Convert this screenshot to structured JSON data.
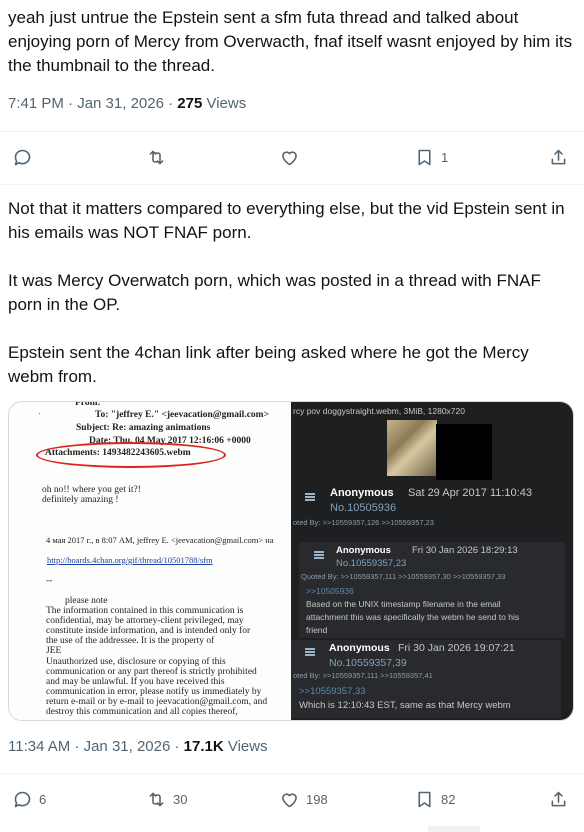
{
  "reply1": {
    "text": "yeah just untrue the Epstein sent a sfm futa thread and talked about enjoying porn of Mercy from Overwacth, fnaf itself wasnt enjoyed by him its the thumbnail to the thread.",
    "time": "7:41 PM · Jan 31, 2026 · ",
    "views_count": "275",
    "views_label": " Views",
    "replies": "",
    "reposts": "",
    "likes": "",
    "bookmarks": "1"
  },
  "reply2": {
    "text": "Not that it matters compared to everything else, but the vid Epstein sent in his emails was NOT FNAF porn.\n\nIt was Mercy Overwatch porn, which was posted in a thread with FNAF porn in the OP.\n\nEpstein sent the 4chan link after being asked where he got the Mercy webm from.",
    "time": "11:34 AM · Jan 31, 2026 · ",
    "views_count": "17.1K",
    "views_label": " Views",
    "replies": "6",
    "reposts": "30",
    "likes": "198",
    "bookmarks": "82"
  },
  "media": {
    "email": {
      "from": "From:",
      "to": "To: \"jeffrey E.\" <jeevacation@gmail.com>",
      "subject": "Subject: Re: amazing animations",
      "date": "Date: Thu, 04 May 2017 12:16:06 +0000",
      "attachments": "Attachments: 1493482243605.webm",
      "q1": "oh no!! where you get it?!",
      "q2": "definitely amazing !",
      "sent": "4 мая 2017 г., в 8:07 AM, jeffrey E. <jeevacation@gmail.com> на",
      "link": "http://boards.4chan.org/gif/thread/10501788/sfm",
      "dash": "--",
      "note1": "please note",
      "body1": "The information contained in this communication is",
      "body2": "confidential, may be attorney-client privileged, may",
      "body3": "constitute inside information, and is intended only for",
      "body4": "the use of the addressee. It is the property of",
      "body5": "JEE",
      "body6": "Unauthorized use, disclosure or copying of this",
      "body7": "communication or any part thereof is strictly prohibited",
      "body8": "and may be unlawful. If you have received this",
      "body9": "communication in error, please notify us immediately by",
      "body10": "return e-mail or by e-mail to jeevacation@gmail.com, and",
      "body11": "destroy this communication and all copies thereof,"
    },
    "chan": {
      "file": "rcy pov doggystraight.webm, 3MiB, 1280x720",
      "p1_name": "Anonymous",
      "p1_date": "Sat 29 Apr 2017 11:10:43",
      "p1_no": "No.10505936",
      "p1_quoted": "oted By: >>10559357,126 >>10559357,23",
      "p2_name": "Anonymous",
      "p2_date": "Fri 30 Jan 2026 18:29:13",
      "p2_no": "No.10559357,23",
      "p2_quoted": "Quoted By: >>10559357,111 >>10559357,30 >>10559357,33",
      "p2_ref": ">>10505936",
      "p2_l1": "Based on the UNIX timestamp filename in the email",
      "p2_l2": "attachment this was specifically the webm he send to his",
      "p2_l3": "friend",
      "p3_name": "Anonymous",
      "p3_date": "Fri 30 Jan 2026 19:07:21",
      "p3_no": "No.10559357,39",
      "p3_quoted": "oted By: >>10559357,111 >>10559357,41",
      "p3_ref": ">>10559357,33",
      "p3_l1": "Which is 12:10:43 EST, same as that Mercy webm"
    }
  },
  "icons": [
    "reply-icon",
    "repost-icon",
    "like-icon",
    "bookmark-icon",
    "share-icon"
  ],
  "colors": {
    "text": "#0f1419",
    "secondary": "#536471",
    "chan_bg": "#1d1f21",
    "oval": "#d22222"
  }
}
